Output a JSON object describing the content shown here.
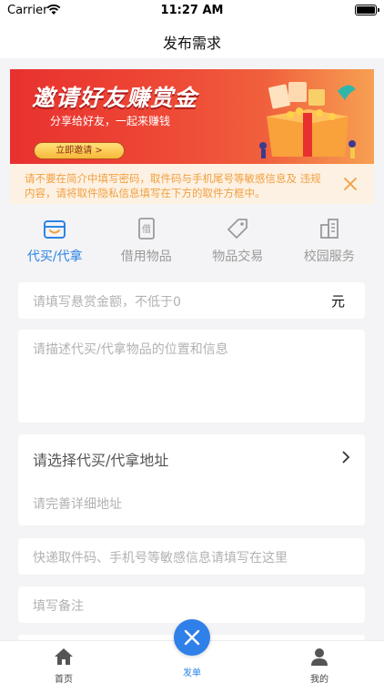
{
  "status_bar": {
    "carrier": "Carrier",
    "time": "11:27 AM"
  },
  "nav": {
    "title": "发布需求"
  },
  "banner": {
    "title": "邀请好友赚赏金",
    "subtitle": "分享给好友，一起来赚钱",
    "button": "立即邀请 >"
  },
  "notice": {
    "text": "请不要在简介中填写密码，取件码与手机尾号等敏感信息及 违规内容，请将取件隐私信息填写在下方的取件方框中。"
  },
  "categories": [
    {
      "label": "代买/代拿",
      "icon": "shopping-bag-icon",
      "active": true
    },
    {
      "label": "借用物品",
      "icon": "borrow-receipt-icon",
      "active": false
    },
    {
      "label": "物品交易",
      "icon": "price-tag-icon",
      "active": false
    },
    {
      "label": "校园服务",
      "icon": "building-icon",
      "active": false
    }
  ],
  "form": {
    "reward_placeholder": "请填写悬赏金额，不低于0",
    "reward_unit": "元",
    "description_placeholder": "请描述代买/代拿物品的位置和信息",
    "address_select": "请选择代买/代拿地址",
    "address_detail_placeholder": "请完善详细地址",
    "sensitive_placeholder": "快递取件码、手机号等敏感信息请填写在这里",
    "remark_placeholder": "填写备注"
  },
  "tab_bar": {
    "home": "首页",
    "post": "发单",
    "mine": "我的"
  },
  "colors": {
    "accent": "#2d84e3",
    "notice_text": "#f0a040",
    "notice_bg": "#fdf1e3",
    "banner": "#e8312f"
  }
}
